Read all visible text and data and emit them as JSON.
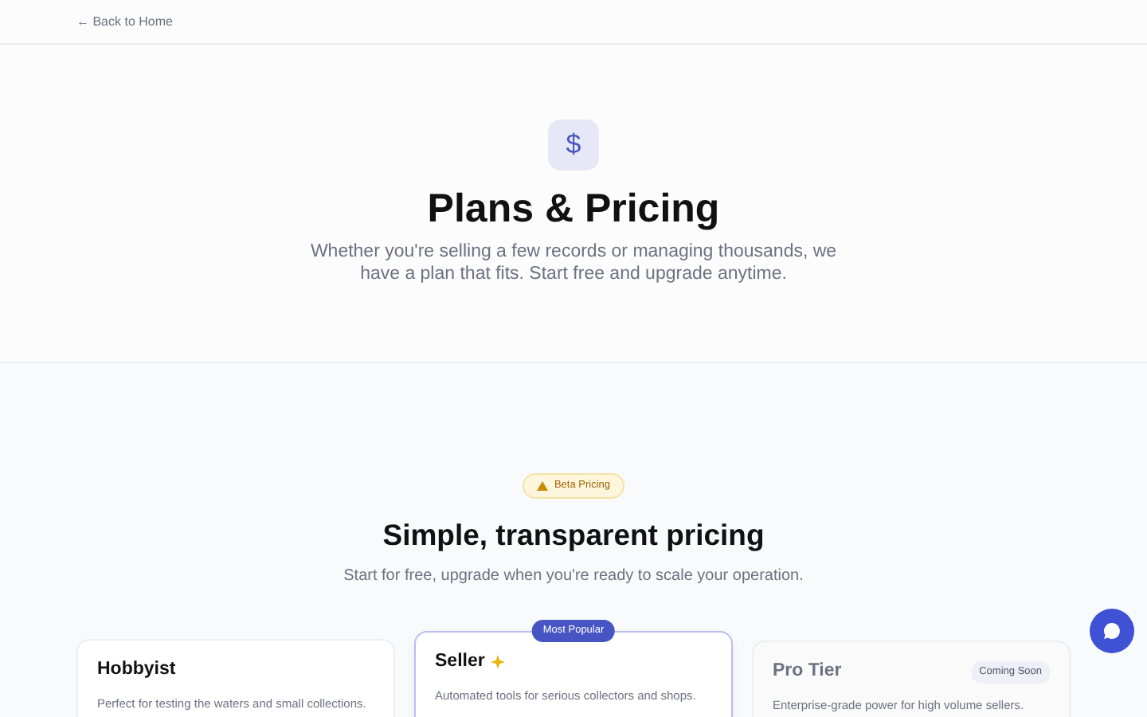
{
  "back_link": {
    "arrow": "←",
    "label": "Back to Home"
  },
  "hero": {
    "icon": "$",
    "title": "Plans & Pricing",
    "description": "Whether you're selling a few records or managing thousands, we have a plan that fits. Start free and upgrade anytime."
  },
  "pricing": {
    "badge": "Beta Pricing",
    "title": "Simple, transparent pricing",
    "subtitle": "Start for free, upgrade when you're ready to scale your operation.",
    "plans": [
      {
        "name": "Hobbyist",
        "description": "Perfect for testing the waters and small collections.",
        "highlighted": false,
        "disabled": false
      },
      {
        "name": "Seller",
        "description": "Automated tools for serious collectors and shops.",
        "badge": "Most Popular",
        "highlighted": true,
        "disabled": false
      },
      {
        "name": "Pro Tier",
        "description": "Enterprise-grade power for high volume sellers.",
        "badge": "Coming Soon",
        "highlighted": false,
        "disabled": true
      }
    ]
  }
}
